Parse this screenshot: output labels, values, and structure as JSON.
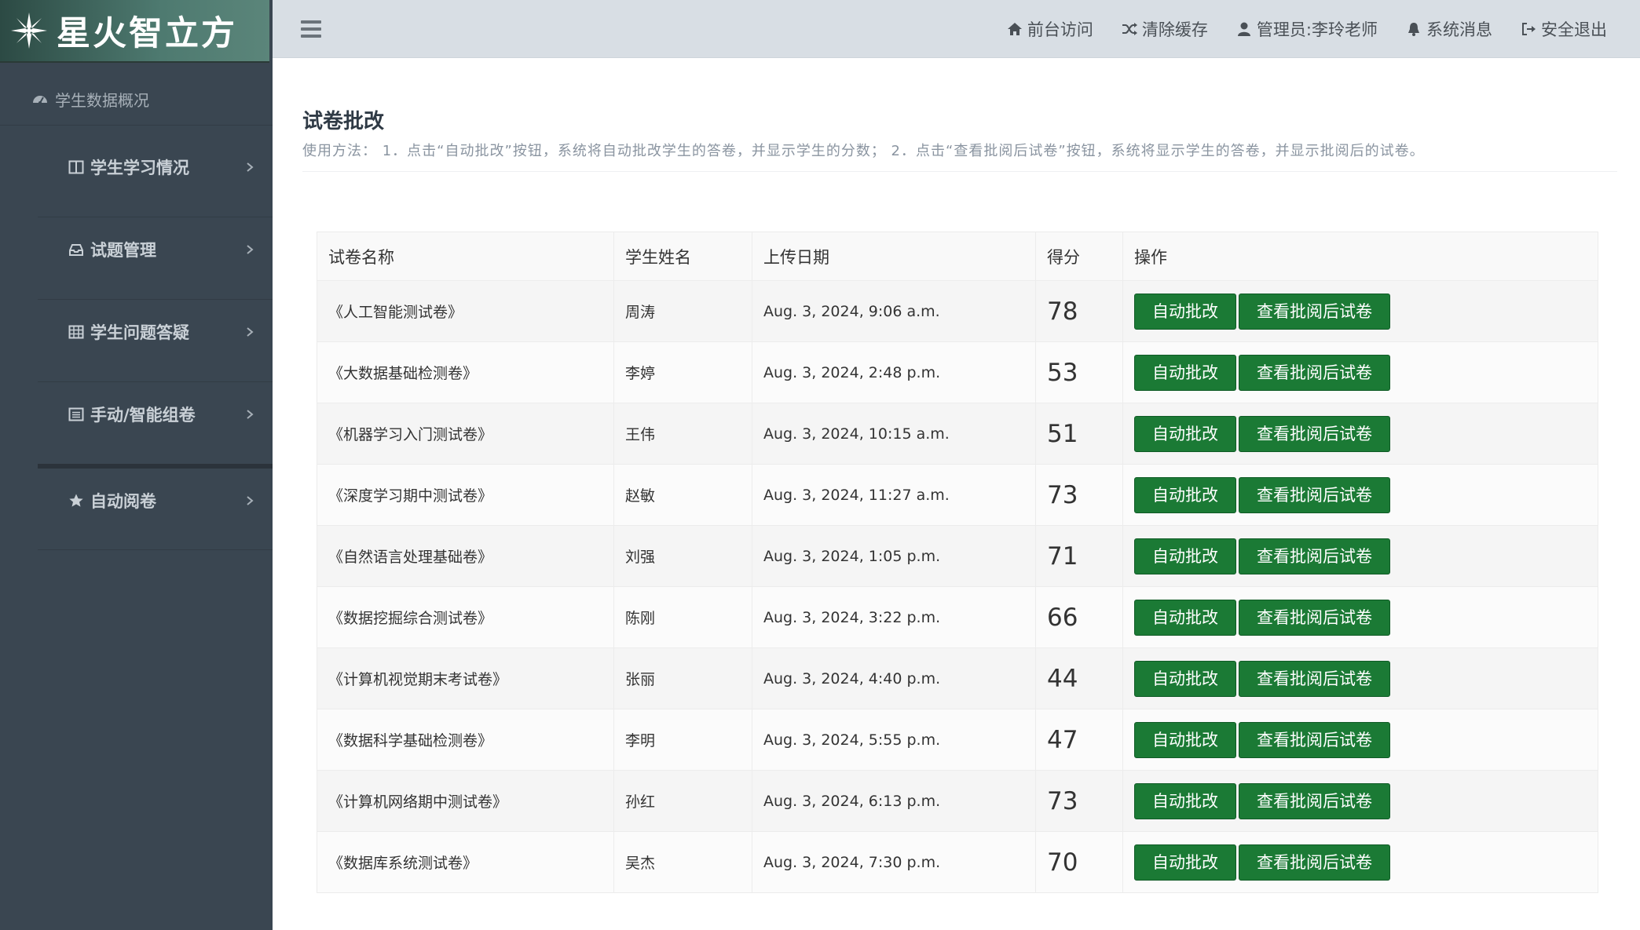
{
  "app": {
    "brand": "星火智立方"
  },
  "sidebar": {
    "overview": "学生数据概况",
    "items": [
      {
        "label": "学生学习情况",
        "icon": "columns-icon"
      },
      {
        "label": "试题管理",
        "icon": "inbox-icon"
      },
      {
        "label": "学生问题答疑",
        "icon": "table-icon"
      },
      {
        "label": "手动/智能组卷",
        "icon": "list-alt-icon"
      },
      {
        "label": "自动阅卷",
        "icon": "star-icon"
      }
    ]
  },
  "header": {
    "links": [
      {
        "label": "前台访问",
        "icon": "home-icon"
      },
      {
        "label": "清除缓存",
        "icon": "random-icon"
      },
      {
        "label": "管理员:李玲老师",
        "icon": "user-icon"
      },
      {
        "label": "系统消息",
        "icon": "bell-icon"
      },
      {
        "label": "安全退出",
        "icon": "sign-out-icon"
      }
    ]
  },
  "main": {
    "title": "试卷批改",
    "usage": "使用方法： 1．点击“自动批改”按钮，系统将自动批改学生的答卷，并显示学生的分数； 2．点击“查看批阅后试卷”按钮，系统将显示学生的答卷，并显示批阅后的试卷。",
    "columns": [
      "试卷名称",
      "学生姓名",
      "上传日期",
      "得分",
      "操作"
    ],
    "auto_grade_label": "自动批改",
    "view_graded_label": "查看批阅后试卷",
    "score_color": "#e4151b",
    "button_color": "#1b7a35",
    "rows": [
      {
        "paper": "《人工智能测试卷》",
        "student": "周涛",
        "date": "Aug. 3, 2024, 9:06 a.m.",
        "score": "78"
      },
      {
        "paper": "《大数据基础检测卷》",
        "student": "李婷",
        "date": "Aug. 3, 2024, 2:48 p.m.",
        "score": "53"
      },
      {
        "paper": "《机器学习入门测试卷》",
        "student": "王伟",
        "date": "Aug. 3, 2024, 10:15 a.m.",
        "score": "51"
      },
      {
        "paper": "《深度学习期中测试卷》",
        "student": "赵敏",
        "date": "Aug. 3, 2024, 11:27 a.m.",
        "score": "73"
      },
      {
        "paper": "《自然语言处理基础卷》",
        "student": "刘强",
        "date": "Aug. 3, 2024, 1:05 p.m.",
        "score": "71"
      },
      {
        "paper": "《数据挖掘综合测试卷》",
        "student": "陈刚",
        "date": "Aug. 3, 2024, 3:22 p.m.",
        "score": "66"
      },
      {
        "paper": "《计算机视觉期末考试卷》",
        "student": "张丽",
        "date": "Aug. 3, 2024, 4:40 p.m.",
        "score": "44"
      },
      {
        "paper": "《数据科学基础检测卷》",
        "student": "李明",
        "date": "Aug. 3, 2024, 5:55 p.m.",
        "score": "47"
      },
      {
        "paper": "《计算机网络期中测试卷》",
        "student": "孙红",
        "date": "Aug. 3, 2024, 6:13 p.m.",
        "score": "73"
      },
      {
        "paper": "《数据库系统测试卷》",
        "student": "吴杰",
        "date": "Aug. 3, 2024, 7:30 p.m.",
        "score": "70"
      }
    ]
  }
}
